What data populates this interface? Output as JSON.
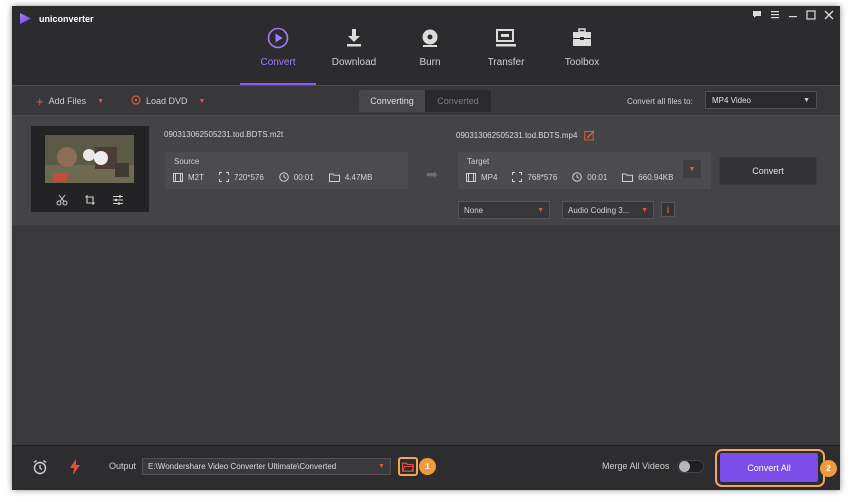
{
  "app": {
    "name": "uniconverter",
    "accent": "#8a5cff"
  },
  "window_controls": [
    "chat-icon",
    "menu-icon",
    "minimize-icon",
    "maximize-icon",
    "close-icon"
  ],
  "nav": {
    "items": [
      {
        "label": "Convert",
        "icon": "convert-play-icon",
        "active": true
      },
      {
        "label": "Download",
        "icon": "download-icon"
      },
      {
        "label": "Burn",
        "icon": "disc-icon"
      },
      {
        "label": "Transfer",
        "icon": "transfer-icon"
      },
      {
        "label": "Toolbox",
        "icon": "toolbox-icon"
      }
    ]
  },
  "toolbar": {
    "add_files": "Add Files",
    "load_dvd": "Load DVD",
    "tabs": [
      "Converting",
      "Converted"
    ],
    "convert_all_to_label": "Convert all files to:",
    "format": "MP4 Video"
  },
  "file": {
    "source_name": "090313062505231.tod.BDTS.m2t",
    "target_name": "090313062505231.tod.BDTS.mp4",
    "source": {
      "title": "Source",
      "format": "M2T",
      "resolution": "720*576",
      "duration": "00:01",
      "size": "4.47MB"
    },
    "target": {
      "title": "Target",
      "format": "MP4",
      "resolution": "768*576",
      "duration": "00:01",
      "size": "660.94KB"
    },
    "convert_label": "Convert",
    "subtitle": "None",
    "audio": "Audio Coding 3...",
    "info": "i"
  },
  "bottom": {
    "output_label": "Output",
    "output_path": "E:\\Wondershare Video Converter Ultimate\\Converted",
    "badge1": "1",
    "merge_label": "Merge All Videos",
    "merge_on": false,
    "convert_all": "Convert All",
    "badge2": "2"
  }
}
